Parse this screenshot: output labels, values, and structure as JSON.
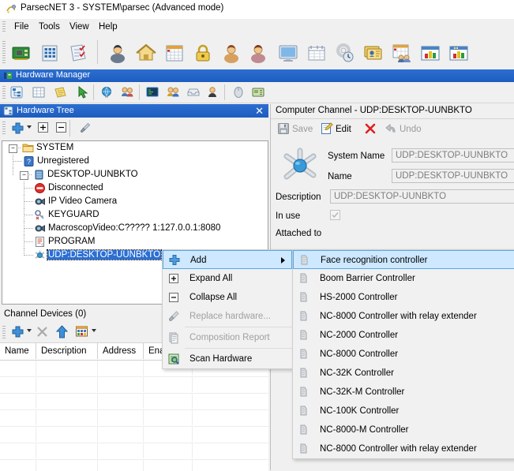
{
  "window": {
    "title": "ParsecNET 3 - SYSTEM\\parsec (Advanced mode)",
    "app_icon": "parsecnet-logo-icon"
  },
  "menubar": {
    "items": [
      {
        "label": "File"
      },
      {
        "label": "Tools"
      },
      {
        "label": "View"
      },
      {
        "label": "Help"
      }
    ]
  },
  "toolbar_main": {
    "buttons": [
      {
        "icon": "network-card-icon"
      },
      {
        "icon": "building-icon"
      },
      {
        "icon": "checklist-icon"
      },
      {
        "icon": "person-manager-icon"
      },
      {
        "icon": "home-icon"
      },
      {
        "icon": "calendar-icon"
      },
      {
        "icon": "padlock-icon"
      },
      {
        "icon": "users-icon"
      },
      {
        "icon": "users-group-icon"
      },
      {
        "icon": "monitor-icon"
      },
      {
        "icon": "schedule-table-icon"
      },
      {
        "icon": "gear-clock-icon"
      },
      {
        "icon": "id-cards-icon"
      },
      {
        "icon": "calendar-people-icon"
      },
      {
        "icon": "bar-chart-window-icon"
      },
      {
        "icon": "bar-chart-report-icon"
      }
    ]
  },
  "hardware_manager_bar": {
    "title": "Hardware Manager",
    "icon": "hardware-manager-icon"
  },
  "toolbar_secondary": {
    "buttons": [
      {
        "icon": "hardware-tree-icon"
      },
      {
        "icon": "grid-icon"
      },
      {
        "icon": "notes-icon"
      },
      {
        "icon": "green-cursor-icon"
      },
      {
        "icon": "globe-icon"
      },
      {
        "icon": "users-pair-icon"
      },
      {
        "icon": "console-icon"
      },
      {
        "icon": "people-blue-icon"
      },
      {
        "icon": "tray-icon"
      },
      {
        "icon": "person-dark-icon"
      },
      {
        "icon": "mouse-icon"
      },
      {
        "icon": "card-reader-icon"
      }
    ]
  },
  "hardware_tree_panel": {
    "title": "Hardware Tree",
    "icon": "hardware-tree-icon",
    "close_label": "✕",
    "toolbar": [
      {
        "icon": "add-plus-icon"
      },
      {
        "icon": "dropdown-caret-icon"
      },
      {
        "icon": "expand-all-icon"
      },
      {
        "icon": "collapse-all-icon"
      },
      {
        "icon": "screwdriver-icon"
      }
    ],
    "nodes": [
      {
        "label": "SYSTEM",
        "icon": "folder-icon",
        "depth": 0,
        "expander": "minus",
        "selected": false
      },
      {
        "label": "Unregistered",
        "icon": "question-icon",
        "depth": 1,
        "expander": "",
        "selected": false
      },
      {
        "label": "DESKTOP-UUNBKTO",
        "icon": "server-icon",
        "depth": 1,
        "expander": "minus",
        "selected": false
      },
      {
        "label": "Disconnected",
        "icon": "disconnected-icon",
        "depth": 2,
        "expander": "",
        "selected": false
      },
      {
        "label": "IP Video Camera",
        "icon": "camera-icon",
        "depth": 2,
        "expander": "",
        "selected": false
      },
      {
        "label": "KEYGUARD",
        "icon": "keyguard-icon",
        "depth": 2,
        "expander": "",
        "selected": false
      },
      {
        "label": "MacroscopVideo:C????? 1:127.0.0.1:8080",
        "icon": "camera-icon",
        "depth": 2,
        "expander": "",
        "selected": false
      },
      {
        "label": "PROGRAM",
        "icon": "program-icon",
        "depth": 2,
        "expander": "",
        "selected": false
      },
      {
        "label": "UDP:DESKTOP-UUNBKTO",
        "icon": "udp-node-icon",
        "depth": 2,
        "expander": "",
        "selected": true
      }
    ]
  },
  "channel_devices_panel": {
    "title": "Channel Devices (0)",
    "toolbar": [
      {
        "icon": "add-plus-icon"
      },
      {
        "icon": "dropdown-caret-icon"
      },
      {
        "icon": "delete-x-icon"
      },
      {
        "icon": "up-arrow-icon"
      },
      {
        "icon": "grid-view-icon"
      },
      {
        "icon": "dropdown-caret-icon"
      }
    ],
    "columns": [
      "Name",
      "Description",
      "Address",
      "Enabled"
    ],
    "rows": []
  },
  "detail_panel": {
    "title": "Computer Channel - UDP:DESKTOP-UUNBKTO",
    "icon": "channel-node-icon",
    "toolbar": [
      {
        "label": "Save",
        "icon": "save-icon",
        "enabled": false
      },
      {
        "label": "Edit",
        "icon": "edit-icon",
        "enabled": true
      },
      {
        "label": "",
        "icon": "delete-x-icon",
        "enabled": true
      },
      {
        "label": "Undo",
        "icon": "undo-icon",
        "enabled": false
      }
    ],
    "fields": [
      {
        "label": "System Name",
        "value": "UDP:DESKTOP-UUNBKTO"
      },
      {
        "label": "Name",
        "value": "UDP:DESKTOP-UUNBKTO"
      },
      {
        "label": "Description",
        "value": "UDP:DESKTOP-UUNBKTO"
      }
    ],
    "in_use": {
      "label": "In use",
      "checked": true
    },
    "attached_to": {
      "label": "Attached to",
      "value": ""
    }
  },
  "context_menu": {
    "items": [
      {
        "label": "Add",
        "icon": "add-plus-icon",
        "enabled": true,
        "highlighted": true,
        "submenu": true
      },
      {
        "label": "Expand All",
        "icon": "expand-all-icon",
        "enabled": true,
        "highlighted": false,
        "submenu": false
      },
      {
        "label": "Collapse All",
        "icon": "collapse-all-icon",
        "enabled": true,
        "highlighted": false,
        "submenu": false
      },
      {
        "label": "Replace hardware...",
        "icon": "screwdriver-icon",
        "enabled": false,
        "highlighted": false,
        "submenu": false
      },
      {
        "label": "Composition Report",
        "icon": "report-icon",
        "enabled": false,
        "highlighted": false,
        "submenu": false
      },
      {
        "label": "Scan Hardware",
        "icon": "scan-icon",
        "enabled": true,
        "highlighted": false,
        "submenu": false
      }
    ]
  },
  "submenu": {
    "items": [
      {
        "label": "Face recognition controller",
        "icon": "controller-icon",
        "highlighted": true
      },
      {
        "label": "Boom Barrier Controller",
        "icon": "controller-icon",
        "highlighted": false
      },
      {
        "label": "HS-2000 Controller",
        "icon": "controller-icon",
        "highlighted": false
      },
      {
        "label": "NC-8000 Controller with relay extender",
        "icon": "controller-icon",
        "highlighted": false
      },
      {
        "label": "NC-2000 Controller",
        "icon": "controller-icon",
        "highlighted": false
      },
      {
        "label": "NC-8000 Controller",
        "icon": "controller-icon",
        "highlighted": false
      },
      {
        "label": "NC-32K Controller",
        "icon": "controller-icon",
        "highlighted": false
      },
      {
        "label": "NC-32K-M Controller",
        "icon": "controller-icon",
        "highlighted": false
      },
      {
        "label": "NC-100K Controller",
        "icon": "controller-icon",
        "highlighted": false
      },
      {
        "label": "NC-8000-M Controller",
        "icon": "controller-icon",
        "highlighted": false
      },
      {
        "label": "NC-8000 Controller with relay extender",
        "icon": "controller-icon",
        "highlighted": false
      }
    ]
  },
  "colors": {
    "caption_blue": "#2c6fd1",
    "selection_blue": "#2b6fd4",
    "menu_highlight": "#cde8ff",
    "menu_highlight_border": "#5ba7e0",
    "panel_bg": "#f0f0f0",
    "disabled_text": "#9a9a9a"
  }
}
